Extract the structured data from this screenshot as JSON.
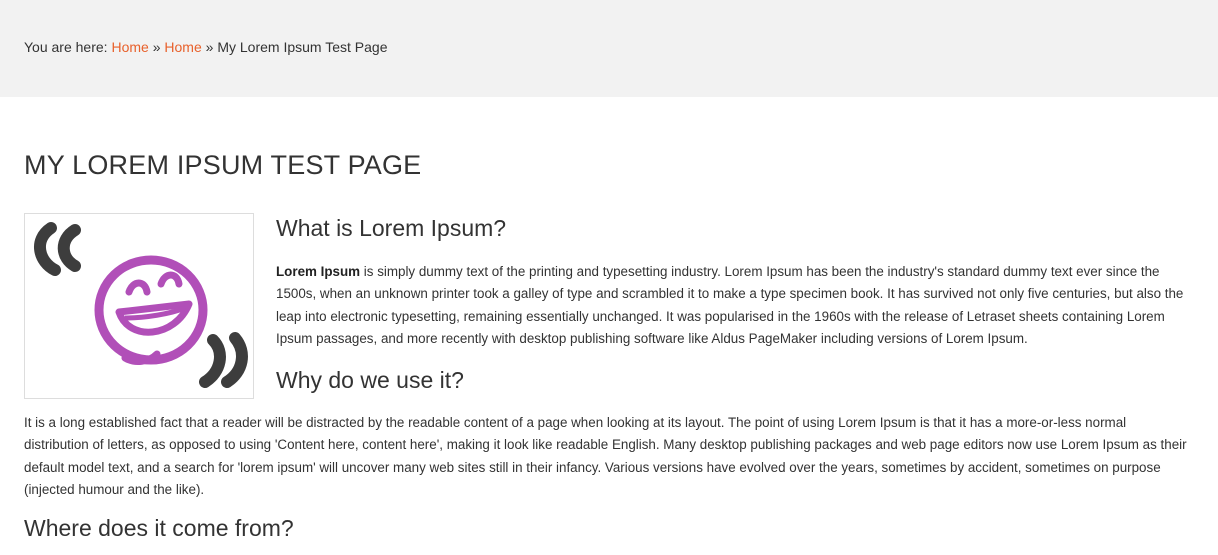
{
  "breadcrumb": {
    "prefix": "You are here:",
    "items": [
      "Home",
      "Home"
    ],
    "separator": "»",
    "current": "My Lorem Ipsum Test Page"
  },
  "page": {
    "title": "MY LOREM IPSUM TEST PAGE"
  },
  "feature_image": {
    "icon": "smiley-quote-icon",
    "colors": {
      "quotes": "#3d3d3d",
      "face": "#b14fb8"
    }
  },
  "sections": {
    "what": {
      "heading": "What is Lorem Ipsum?",
      "bold_lead": "Lorem Ipsum",
      "body": " is simply dummy text of the printing and typesetting industry. Lorem Ipsum has been the industry's standard dummy text ever since the 1500s, when an unknown printer took a galley of type and scrambled it to make a type specimen book. It has survived not only five centuries, but also the leap into electronic typesetting, remaining essentially unchanged. It was popularised in the 1960s with the release of Letraset sheets containing Lorem Ipsum passages, and more recently with desktop publishing software like Aldus PageMaker including versions of Lorem Ipsum."
    },
    "why": {
      "heading": "Why do we use it?",
      "body": "It is a long established fact that a reader will be distracted by the readable content of a page when looking at its layout. The point of using Lorem Ipsum is that it has a more-or-less normal distribution of letters, as opposed to using 'Content here, content here', making it look like readable English. Many desktop publishing packages and web page editors now use Lorem Ipsum as their default model text, and a search for 'lorem ipsum' will uncover many web sites still in their infancy. Various versions have evolved over the years, sometimes by accident, sometimes on purpose (injected humour and the like)."
    },
    "where": {
      "heading": "Where does it come from?"
    }
  },
  "colors": {
    "link": "#e8612c",
    "text": "#333333",
    "breadcrumb_bg": "#f2f2f2"
  }
}
